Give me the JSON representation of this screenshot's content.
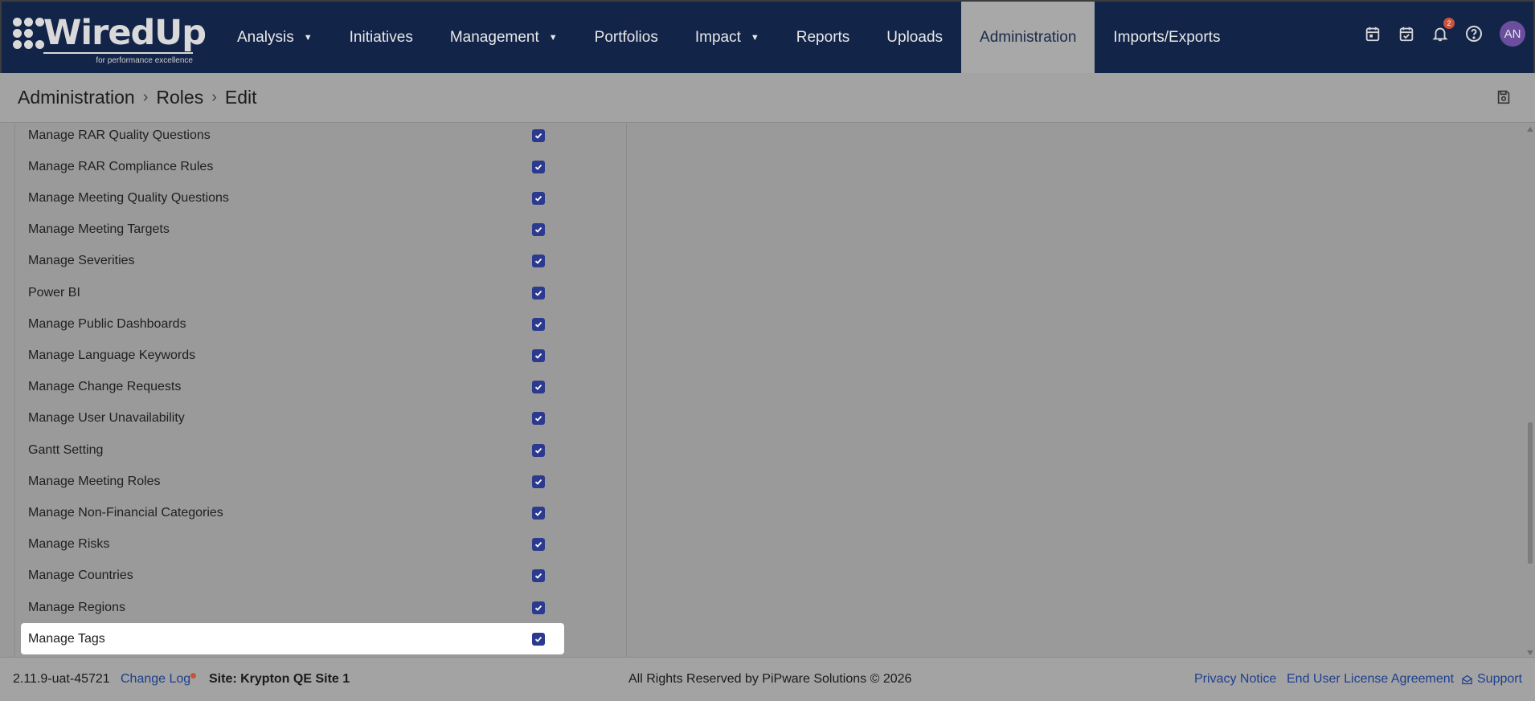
{
  "app": {
    "logo_text": "WiredUp",
    "logo_tagline": "for performance excellence"
  },
  "nav": {
    "items": [
      {
        "label": "Analysis",
        "dropdown": true,
        "active": false
      },
      {
        "label": "Initiatives",
        "dropdown": false,
        "active": false
      },
      {
        "label": "Management",
        "dropdown": true,
        "active": false
      },
      {
        "label": "Portfolios",
        "dropdown": false,
        "active": false
      },
      {
        "label": "Impact",
        "dropdown": true,
        "active": false
      },
      {
        "label": "Reports",
        "dropdown": false,
        "active": false
      },
      {
        "label": "Uploads",
        "dropdown": false,
        "active": false
      },
      {
        "label": "Administration",
        "dropdown": false,
        "active": true
      },
      {
        "label": "Imports/Exports",
        "dropdown": false,
        "active": false
      }
    ],
    "notification_count": "2",
    "avatar_initials": "AN"
  },
  "breadcrumb": {
    "items": [
      "Administration",
      "Roles",
      "Edit"
    ]
  },
  "permissions": [
    {
      "label": "Manage RAR Quality Questions",
      "checked": true
    },
    {
      "label": "Manage RAR Compliance Rules",
      "checked": true
    },
    {
      "label": "Manage Meeting Quality Questions",
      "checked": true
    },
    {
      "label": "Manage Meeting Targets",
      "checked": true
    },
    {
      "label": "Manage Severities",
      "checked": true
    },
    {
      "label": "Power BI",
      "checked": true
    },
    {
      "label": "Manage Public Dashboards",
      "checked": true
    },
    {
      "label": "Manage Language Keywords",
      "checked": true
    },
    {
      "label": "Manage Change Requests",
      "checked": true
    },
    {
      "label": "Manage User Unavailability",
      "checked": true
    },
    {
      "label": "Gantt Setting",
      "checked": true
    },
    {
      "label": "Manage Meeting Roles",
      "checked": true
    },
    {
      "label": "Manage Non-Financial Categories",
      "checked": true
    },
    {
      "label": "Manage Risks",
      "checked": true
    },
    {
      "label": "Manage Countries",
      "checked": true
    },
    {
      "label": "Manage Regions",
      "checked": true
    },
    {
      "label": "Manage Tags",
      "checked": true,
      "highlighted": true
    }
  ],
  "footer": {
    "version": "2.11.9-uat-45721",
    "change_log": "Change Log",
    "site": "Site: Krypton QE Site 1",
    "rights": "All Rights Reserved by PiPware Solutions © 2026",
    "privacy": "Privacy Notice",
    "eula": "End User License Agreement",
    "support": "Support"
  },
  "colors": {
    "nav_bg": "#132449",
    "checkbox": "#2b3a8f",
    "link": "#1d3f8f",
    "badge": "#c9533c"
  }
}
